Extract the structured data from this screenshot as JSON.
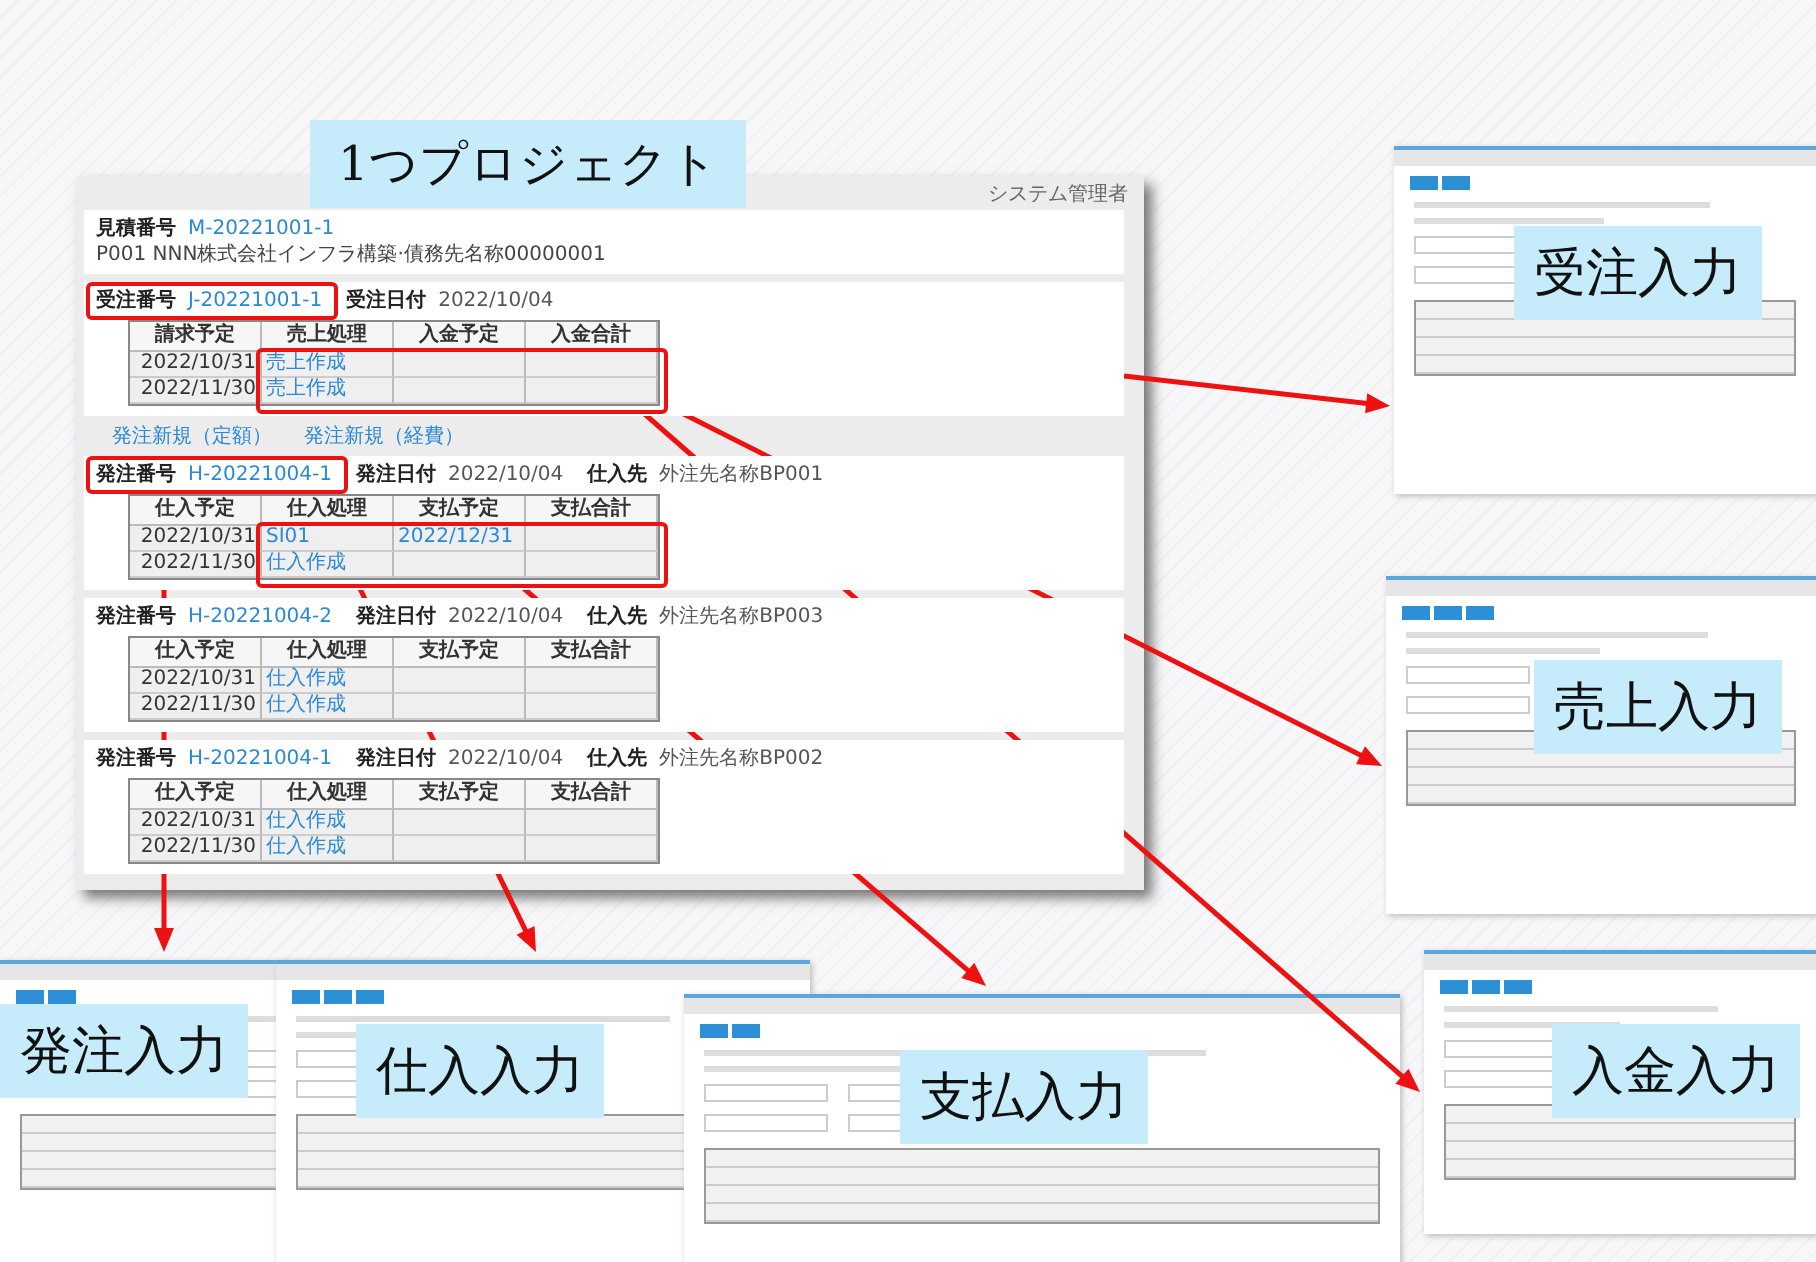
{
  "title_label": "1つプロジェクト",
  "main_screen": {
    "user": "システム管理者",
    "estimate": {
      "label": "見積番号",
      "number": "M-20221001-1",
      "description": "P001 NNN株式会社インフラ構築·債務先名称00000001"
    },
    "order": {
      "highlighted": true,
      "fields": [
        {
          "label": "受注番号",
          "value": "J-20221001-1",
          "kind": "link"
        },
        {
          "label": "受注日付",
          "value": "2022/10/04",
          "kind": "plain"
        }
      ],
      "columns": [
        "請求予定",
        "売上処理",
        "入金予定",
        "入金合計"
      ],
      "rows": [
        {
          "date": "2022/10/31",
          "process": "売上作成"
        },
        {
          "date": "2022/11/30",
          "process": "売上作成"
        }
      ]
    },
    "links": [
      "発注新規（定額）",
      "発注新規（経費）"
    ],
    "purchase_orders": [
      {
        "highlighted": true,
        "fields": [
          {
            "label": "発注番号",
            "value": "H-20221004-1",
            "kind": "link"
          },
          {
            "label": "発注日付",
            "value": "2022/10/04",
            "kind": "plain"
          },
          {
            "label": "仕入先",
            "value": "外注先名称BP001",
            "kind": "plain"
          }
        ],
        "columns": [
          "仕入予定",
          "仕入処理",
          "支払予定",
          "支払合計"
        ],
        "rows": [
          {
            "date": "2022/10/31",
            "process": "SI01",
            "payment_date": "2022/12/31"
          },
          {
            "date": "2022/11/30",
            "process": "仕入作成"
          }
        ]
      },
      {
        "highlighted": false,
        "fields": [
          {
            "label": "発注番号",
            "value": "H-20221004-2",
            "kind": "link"
          },
          {
            "label": "発注日付",
            "value": "2022/10/04",
            "kind": "plain"
          },
          {
            "label": "仕入先",
            "value": "外注先名称BP003",
            "kind": "plain"
          }
        ],
        "columns": [
          "仕入予定",
          "仕入処理",
          "支払予定",
          "支払合計"
        ],
        "rows": [
          {
            "date": "2022/10/31",
            "process": "仕入作成"
          },
          {
            "date": "2022/11/30",
            "process": "仕入作成"
          }
        ]
      },
      {
        "highlighted": false,
        "fields": [
          {
            "label": "発注番号",
            "value": "H-20221004-1",
            "kind": "link"
          },
          {
            "label": "発注日付",
            "value": "2022/10/04",
            "kind": "plain"
          },
          {
            "label": "仕入先",
            "value": "外注先名称BP002",
            "kind": "plain"
          }
        ],
        "columns": [
          "仕入予定",
          "仕入処理",
          "支払予定",
          "支払合計"
        ],
        "rows": [
          {
            "date": "2022/10/31",
            "process": "仕入作成"
          },
          {
            "date": "2022/11/30",
            "process": "仕入作成"
          }
        ]
      }
    ]
  },
  "screens": [
    {
      "label": "受注入力"
    },
    {
      "label": "売上入力"
    },
    {
      "label": "発注入力"
    },
    {
      "label": "仕入入力"
    },
    {
      "label": "支払入力"
    },
    {
      "label": "入金入力"
    }
  ]
}
